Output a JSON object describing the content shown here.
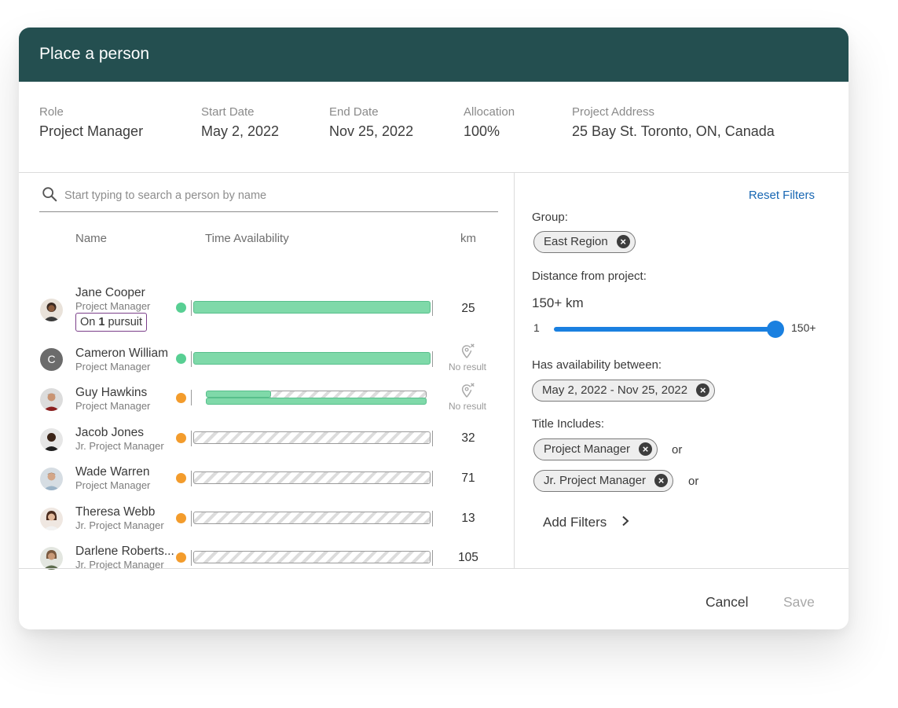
{
  "dialog": {
    "title": "Place a person"
  },
  "summary": [
    {
      "label": "Role",
      "value": "Project Manager"
    },
    {
      "label": "Start Date",
      "value": "May 2, 2022"
    },
    {
      "label": "End Date",
      "value": "Nov 25, 2022"
    },
    {
      "label": "Allocation",
      "value": "100%"
    },
    {
      "label": "Project Address",
      "value": "25 Bay St. Toronto, ON, Canada"
    }
  ],
  "search": {
    "placeholder": "Start typing to search a person by name"
  },
  "columns": {
    "name": "Name",
    "availability": "Time Availability",
    "km": "km"
  },
  "people": [
    {
      "name": "Jane Cooper",
      "title": "Project Manager",
      "pursuit_prefix": "On ",
      "pursuit_count": "1",
      "pursuit_suffix": " pursuit",
      "status": "green",
      "availability": "full",
      "km": "25"
    },
    {
      "name": "Cameron William",
      "title": "Project Manager",
      "initial": "C",
      "status": "green",
      "availability": "full",
      "km": "",
      "no_result": "No result"
    },
    {
      "name": "Guy Hawkins",
      "title": "Project Manager",
      "status": "orange",
      "availability": "partial",
      "km": "",
      "no_result": "No result"
    },
    {
      "name": "Jacob Jones",
      "title": "Jr. Project Manager",
      "status": "orange",
      "availability": "none",
      "km": "32"
    },
    {
      "name": "Wade Warren",
      "title": "Project Manager",
      "status": "orange",
      "availability": "none",
      "km": "71"
    },
    {
      "name": "Theresa Webb",
      "title": "Jr. Project Manager",
      "status": "orange",
      "availability": "none",
      "km": "13"
    },
    {
      "name": "Darlene Roberts...",
      "title": "Jr. Project Manager",
      "status": "orange",
      "availability": "none",
      "km": "105"
    }
  ],
  "filters": {
    "reset": "Reset Filters",
    "group_label": "Group:",
    "group_chip": "East Region",
    "distance_label": "Distance from project:",
    "distance_value": "150+ km",
    "slider_min": "1",
    "slider_max": "150+",
    "slider_level": 1.0,
    "availability_label": "Has availability between:",
    "availability_chip": "May 2, 2022 - Nov 25, 2022",
    "title_label": "Title Includes:",
    "title_chips": [
      "Project Manager",
      "Jr. Project Manager"
    ],
    "or": "or",
    "add_filters": "Add Filters"
  },
  "footer": {
    "cancel": "Cancel",
    "save": "Save"
  },
  "colors": {
    "header": "#244f50",
    "available": "#7fd9a9",
    "status_green": "#58cf93",
    "status_orange": "#f39c2c",
    "accent": "#1a80e0",
    "link": "#1867b3"
  }
}
